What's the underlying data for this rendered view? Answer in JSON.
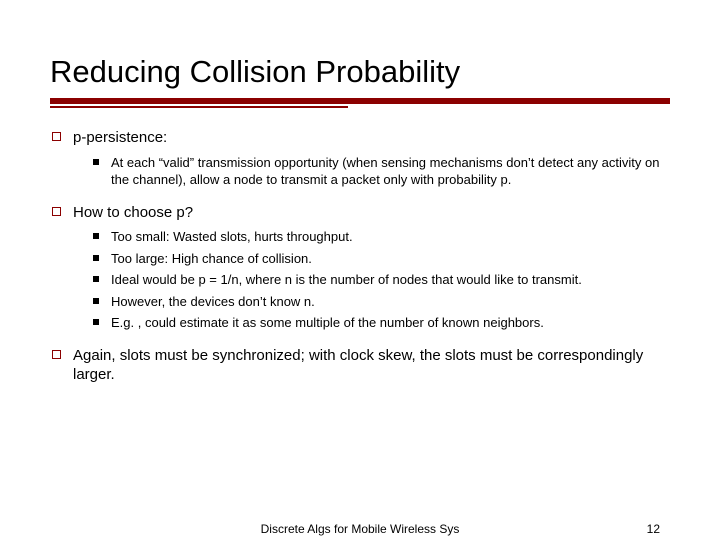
{
  "title": "Reducing Collision Probability",
  "bullets": [
    {
      "text": "p-persistence:",
      "sub": [
        "At each “valid” transmission opportunity (when sensing mechanisms don’t detect any activity on the channel), allow a node to transmit a packet only with probability p."
      ]
    },
    {
      "text": "How to choose p?",
      "sub": [
        "Too small:  Wasted slots, hurts throughput.",
        "Too large:  High chance of collision.",
        "Ideal would be p = 1/n, where n is the number of nodes that would like to transmit.",
        "However, the devices don’t know n.",
        "E.g. , could estimate it as some multiple of the number of known neighbors."
      ]
    },
    {
      "text": "Again, slots must be synchronized; with clock skew, the slots must be correspondingly larger.",
      "sub": []
    }
  ],
  "footer": {
    "center": "Discrete Algs for Mobile Wireless Sys",
    "pageNumber": "12"
  }
}
